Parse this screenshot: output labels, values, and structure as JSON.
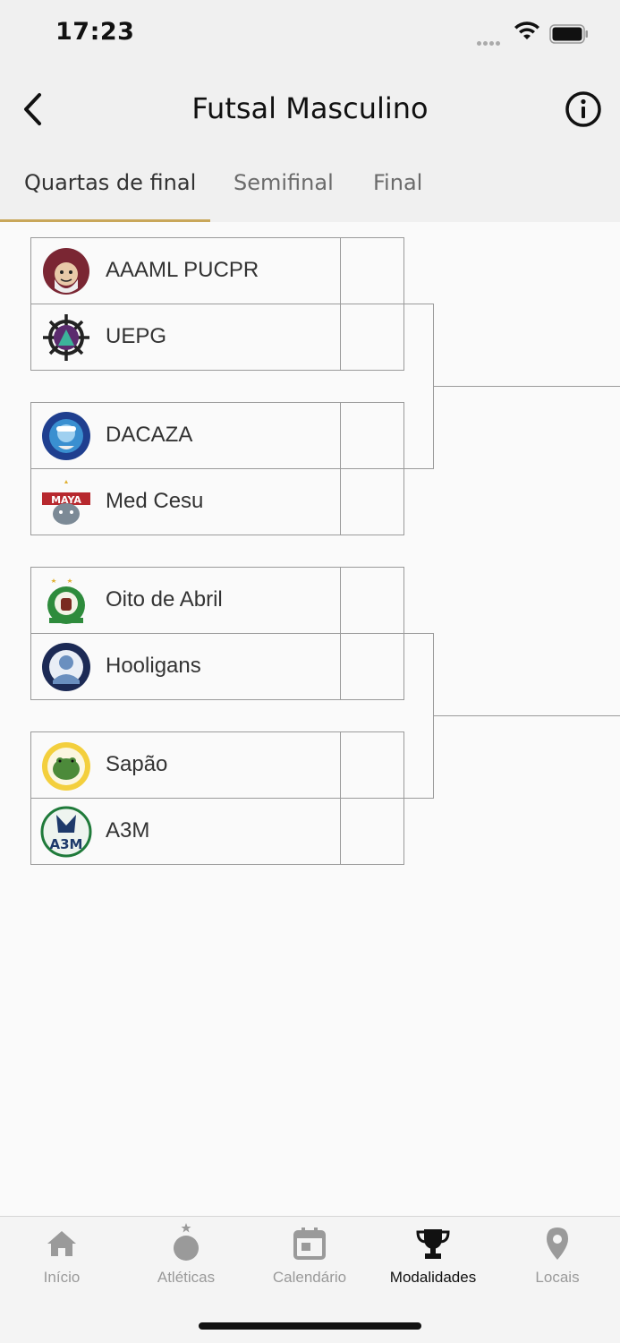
{
  "status": {
    "time": "17:23"
  },
  "nav": {
    "title": "Futsal Masculino"
  },
  "tabs": [
    {
      "label": "Quartas de final",
      "active": true
    },
    {
      "label": "Semifinal",
      "active": false
    },
    {
      "label": "Final",
      "active": false
    }
  ],
  "matches": [
    {
      "teams": [
        {
          "name": "AAAML PUCPR",
          "score": ""
        },
        {
          "name": "UEPG",
          "score": ""
        }
      ]
    },
    {
      "teams": [
        {
          "name": "DACAZA",
          "score": ""
        },
        {
          "name": "Med Cesu",
          "score": ""
        }
      ]
    },
    {
      "teams": [
        {
          "name": "Oito de Abril",
          "score": ""
        },
        {
          "name": "Hooligans",
          "score": ""
        }
      ]
    },
    {
      "teams": [
        {
          "name": "Sapão",
          "score": ""
        },
        {
          "name": "A3M",
          "score": ""
        }
      ]
    }
  ],
  "bottom_nav": [
    {
      "label": "Início",
      "icon": "home-icon",
      "active": false
    },
    {
      "label": "Atléticas",
      "icon": "medal-icon",
      "active": false
    },
    {
      "label": "Calendário",
      "icon": "calendar-icon",
      "active": false
    },
    {
      "label": "Modalidades",
      "icon": "trophy-icon",
      "active": true
    },
    {
      "label": "Locais",
      "icon": "location-pin-icon",
      "active": false
    }
  ],
  "colors": {
    "accent": "#c9a75a",
    "inactive": "#9a9a9a",
    "active": "#111111"
  }
}
